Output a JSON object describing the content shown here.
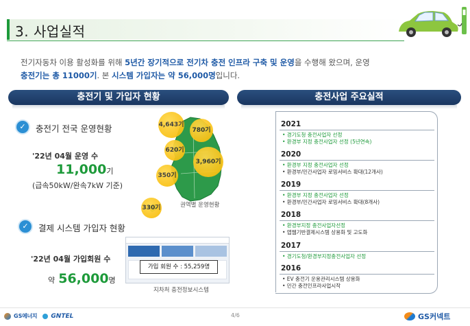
{
  "header": {
    "title": "3. 사업실적"
  },
  "intro": {
    "p1": "전기자동차 이용 활성화를 위해 ",
    "hl1": "5년간 장기적으로 전기차 충전 인프라 구축 및 운영",
    "p2": "을 수행해 왔으며, 운영",
    "hl2": "충전기는 총 11000기",
    "p3": ". 본 ",
    "hl3": "시스템 가입자는 약 56,000명",
    "p4": "입니다."
  },
  "left_panel": {
    "heading": "충전기 및 가입자 현황",
    "section1": {
      "title": "충전기 전국 운영현황",
      "date_label": "'22년 04월 운영 수",
      "value": "11,000",
      "unit": "기",
      "note": "(급속50kW/완속7kW 기준)",
      "map_caption": "권역별 운영현황",
      "regions": [
        "4,643기",
        "780기",
        "620기",
        "3,960기",
        "350기",
        "330기"
      ]
    },
    "section2": {
      "title": "결제 시스템 가입자 현황",
      "date_label": "'22년 04월 가입회원 수",
      "prefix": "약",
      "value": "56,000",
      "unit": "명",
      "popup": "가입 회원 수 : 55,259명",
      "caption": "지차처 충전정보시스템"
    }
  },
  "right_panel": {
    "heading": "충전사업 주요실적",
    "years": [
      {
        "year": "2021",
        "items": [
          {
            "text": "• 경기도청 충전사업자 선정",
            "color": "green"
          },
          {
            "text": "• 환경부 지정 충전사업자 선정 (5년연속)",
            "color": "green"
          }
        ]
      },
      {
        "year": "2020",
        "items": [
          {
            "text": "• 환경부 지정 충전사업자 선정",
            "color": "green"
          },
          {
            "text": "• 환경부/민간사업자 로밍서비스 확대(12개사)",
            "color": "dark"
          }
        ]
      },
      {
        "year": "2019",
        "items": [
          {
            "text": "• 환경부 지정 충전사업자 선정",
            "color": "green"
          },
          {
            "text": "• 환경부/민간사업자 로밍서비스 확대(8개사)",
            "color": "dark"
          }
        ]
      },
      {
        "year": "2018",
        "items": [
          {
            "text": "• 환경부지정 충전사업자선정",
            "color": "green"
          },
          {
            "text": "• 앱웹기반결제시스템 상용화 및 고도화",
            "color": "dark"
          }
        ]
      },
      {
        "year": "2017",
        "items": [
          {
            "text": "• 경기도청/환경부지정충전사업자 선정",
            "color": "green"
          }
        ]
      },
      {
        "year": "2016",
        "items": [
          {
            "text": "• EV 충전기 운용관리시스템 상용화",
            "color": "dark"
          },
          {
            "text": "• 민간 충전인프라사업시작",
            "color": "dark"
          }
        ]
      }
    ]
  },
  "footer": {
    "page": "4/6",
    "logo_left_1": "GS에너지",
    "logo_left_2": "GNTEL",
    "logo_right": "GS커넥트"
  },
  "colors": {
    "accent_green": "#1d9a3a",
    "navy": "#1a3660",
    "blue_text": "#1f5aa6",
    "bubble": "#f7b800"
  }
}
